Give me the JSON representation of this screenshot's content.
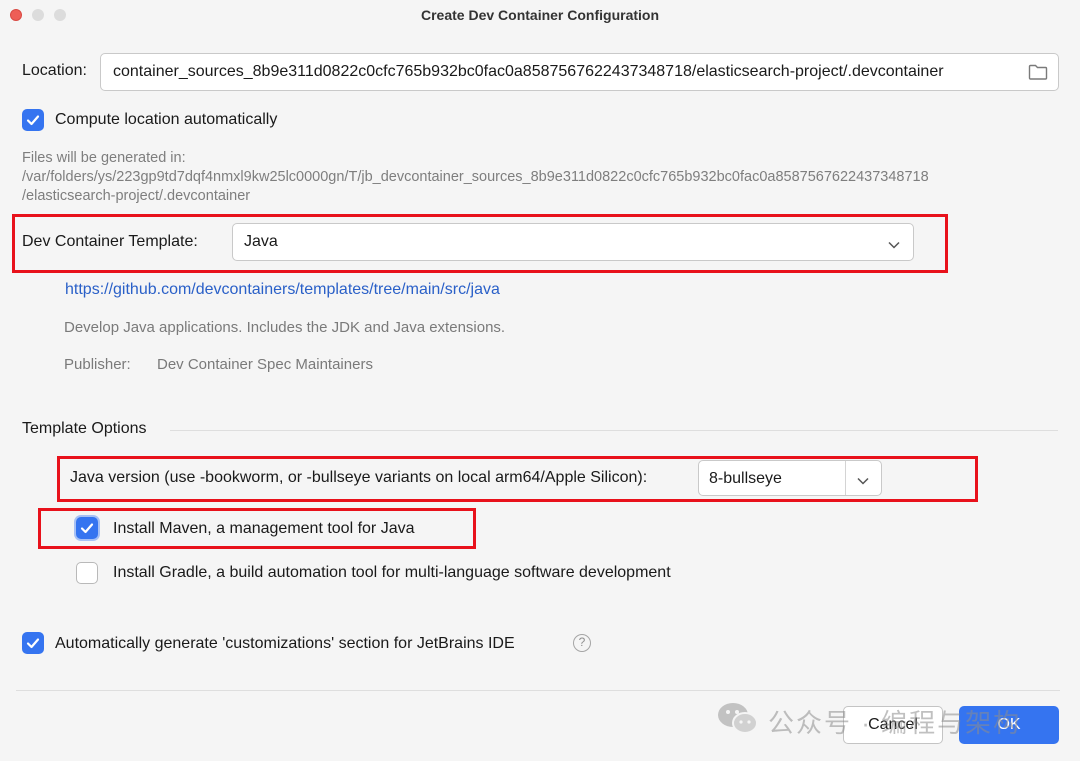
{
  "window": {
    "title": "Create Dev Container Configuration"
  },
  "location": {
    "label": "Location:",
    "value": "container_sources_8b9e311d0822c0cfc765b932bc0fac0a8587567622437348718/elasticsearch-project/.devcontainer"
  },
  "compute_location": {
    "label": "Compute location automatically",
    "checked": true
  },
  "files_hint": {
    "line1": "Files will be generated in:",
    "line2": "/var/folders/ys/223gp9td7dqf4nmxl9kw25lc0000gn/T/jb_devcontainer_sources_8b9e311d0822c0cfc765b932bc0fac0a8587567622437348718",
    "line3": "/elasticsearch-project/.devcontainer"
  },
  "template": {
    "label": "Dev Container Template:",
    "selected": "Java",
    "url": "https://github.com/devcontainers/templates/tree/main/src/java",
    "description": "Develop Java applications. Includes the JDK and Java extensions.",
    "publisher_label": "Publisher:",
    "publisher": "Dev Container Spec Maintainers"
  },
  "template_options": {
    "heading": "Template Options",
    "java_version_label": "Java version (use -bookworm, or -bullseye variants on local arm64/Apple Silicon):",
    "java_version_value": "8-bullseye",
    "install_maven": {
      "label": "Install Maven, a management tool for Java",
      "checked": true
    },
    "install_gradle": {
      "label": "Install Gradle, a build automation tool for multi-language software development",
      "checked": false
    }
  },
  "customizations": {
    "label": "Automatically generate 'customizations' section for JetBrains IDE",
    "checked": true,
    "help": "?"
  },
  "buttons": {
    "cancel": "Cancel",
    "ok": "OK"
  },
  "watermark": {
    "text": "公众号 · 编程与架构"
  },
  "icons": {
    "folder": "folder-icon",
    "chevron": "chevron-down-icon",
    "check": "checkmark-icon",
    "help": "help-icon"
  },
  "colors": {
    "accent": "#3574f0",
    "annotation": "#e8111b",
    "link": "#2a60c8"
  }
}
